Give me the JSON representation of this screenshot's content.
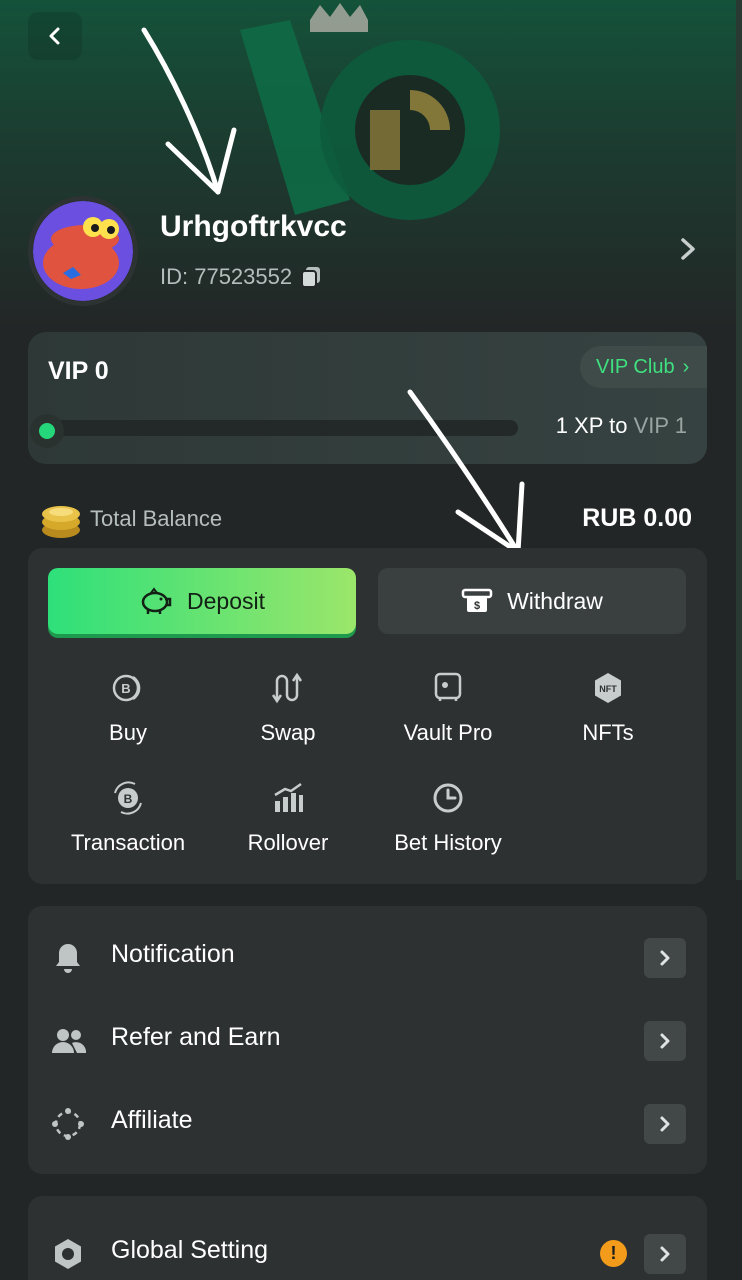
{
  "profile": {
    "username": "Urhgoftrkvcc",
    "id_text": "ID: 77523552"
  },
  "vip": {
    "title": "VIP 0",
    "club_label": "VIP Club",
    "xp_prefix": "1 XP to",
    "next_level": "VIP 1",
    "progress": 0
  },
  "balance": {
    "label": "Total Balance",
    "value": "RUB 0.00"
  },
  "wallet": {
    "deposit_label": "Deposit",
    "withdraw_label": "Withdraw",
    "actions": [
      {
        "label": "Buy",
        "icon": "bitcoin-coin-icon"
      },
      {
        "label": "Swap",
        "icon": "swap-icon"
      },
      {
        "label": "Vault Pro",
        "icon": "vault-icon"
      },
      {
        "label": "NFTs",
        "icon": "nft-icon"
      },
      {
        "label": "Transaction",
        "icon": "transaction-icon"
      },
      {
        "label": "Rollover",
        "icon": "rollover-icon"
      },
      {
        "label": "Bet History",
        "icon": "clock-icon"
      }
    ]
  },
  "menu": {
    "items": [
      {
        "label": "Notification",
        "icon": "bell-icon"
      },
      {
        "label": "Refer and Earn",
        "icon": "users-icon"
      },
      {
        "label": "Affiliate",
        "icon": "affiliate-icon"
      }
    ],
    "global_setting": {
      "label": "Global Setting",
      "badge": "!"
    }
  },
  "colors": {
    "accent": "#25d67a",
    "background": "#232626",
    "card": "#2d3131",
    "warning": "#f39b1a"
  }
}
